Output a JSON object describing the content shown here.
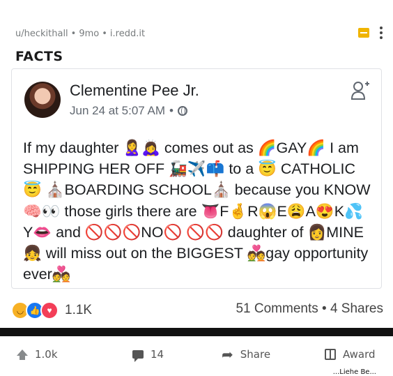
{
  "header": {
    "subreddit": "u/heckithall",
    "age": "9mo",
    "domain": "i.redd.it",
    "title": "FACTS"
  },
  "fb_post": {
    "author": "Clementine Pee Jr.",
    "date": "Jun 24 at 5:07 AM",
    "text": "If my daughter 🙎‍♀️🙇‍♀️ comes out as 🌈GAY🌈 I am SHIPPING HER OFF 🚂✈️📫 to a 😇 CATHOLIC😇 ⛪BOARDING SCHOOL⛪ because you KNOW🧠👀 those girls there are 👅F🤞R😱E😩A😍K💦Y👄 and 🚫🚫🚫NO🚫 🚫🚫 daughter of 👩MINE👧 will miss out on the BIGGEST 💑gay opportunity ever💑",
    "reaction_count": "1.1K",
    "comments_shares": "51 Comments • 4 Shares"
  },
  "actions": {
    "upvotes": "1.0k",
    "comments": "14",
    "share": "Share",
    "award": "Award"
  },
  "cut_text": "...Liehe Be..."
}
